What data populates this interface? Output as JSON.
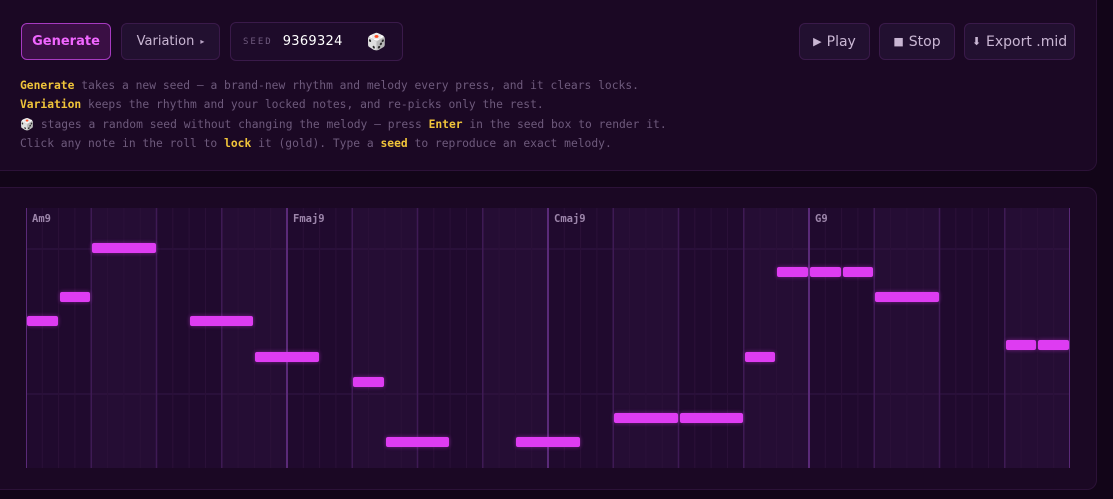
{
  "toolbar": {
    "generate_label": "Generate",
    "variation_label": "Variation",
    "variation_caret": "▸",
    "seed_label": "SEED",
    "seed_value": "9369324",
    "dice_icon": "dice-icon",
    "play_label": "Play",
    "play_icon": "▶",
    "stop_label": "Stop",
    "stop_icon": "■",
    "export_label": "Export .mid",
    "export_icon": "⬇"
  },
  "help": {
    "line1": {
      "key": "Generate",
      "rest": " takes a new seed — a brand-new rhythm and melody every press, and it clears locks."
    },
    "line2": {
      "key": "Variation",
      "rest": " keeps the rhythm and your locked notes, and re-picks only the rest."
    },
    "line3": {
      "icon": "🎲",
      "pre": " stages a random seed without changing the melody — press ",
      "key": "Enter",
      "rest": " in the seed box to render it."
    },
    "line4": {
      "pre": "Click any note in the roll to ",
      "key1": "lock",
      "mid": " it (gold). Type a ",
      "key2": "seed",
      "rest": " to reproduce an exact melody."
    }
  },
  "roll": {
    "bars": 4,
    "steps_per_bar": 16,
    "chords": [
      "Am9",
      "Fmaj9",
      "Cmaj9",
      "G9"
    ],
    "colors": {
      "note": "#de3cf2",
      "lock": "#f0c43a",
      "bar_line": "#5a2a78",
      "beat_line": "#3e1a54"
    },
    "notes": [
      {
        "step": 0,
        "len": 2,
        "pitch": 4
      },
      {
        "step": 2,
        "len": 2,
        "pitch": 3
      },
      {
        "step": 4,
        "len": 4,
        "pitch": 1
      },
      {
        "step": 10,
        "len": 4,
        "pitch": 4
      },
      {
        "step": 14,
        "len": 4,
        "pitch": 5.5
      },
      {
        "step": 20,
        "len": 2,
        "pitch": 6.5
      },
      {
        "step": 22,
        "len": 4,
        "pitch": 9
      },
      {
        "step": 30,
        "len": 4,
        "pitch": 9
      },
      {
        "step": 36,
        "len": 4,
        "pitch": 8
      },
      {
        "step": 40,
        "len": 4,
        "pitch": 8
      },
      {
        "step": 44,
        "len": 2,
        "pitch": 5.5
      },
      {
        "step": 46,
        "len": 2,
        "pitch": 2
      },
      {
        "step": 48,
        "len": 2,
        "pitch": 2
      },
      {
        "step": 50,
        "len": 2,
        "pitch": 2
      },
      {
        "step": 52,
        "len": 4,
        "pitch": 3
      },
      {
        "step": 60,
        "len": 2,
        "pitch": 5
      },
      {
        "step": 62,
        "len": 2,
        "pitch": 5
      }
    ]
  }
}
